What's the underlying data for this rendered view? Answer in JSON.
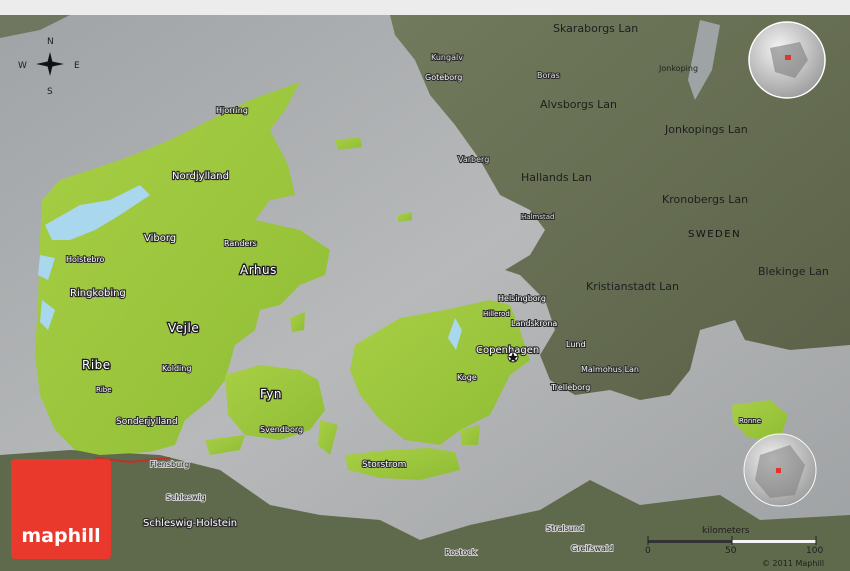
{
  "map": {
    "country": "Denmark",
    "style": "satellite, desaturated, with 3D relief",
    "colors": {
      "land_highlight": "#9dc93a",
      "water": "#a8acae",
      "neighbor_land": "#6a7257"
    }
  },
  "compass": {
    "north": "N",
    "south": "S",
    "east": "E",
    "west": "W"
  },
  "neighbor_country": "SWEDEN",
  "regions": {
    "nordjylland": "Nordjylland",
    "arhus": "Arhus",
    "ringkobing": "Ringkobing",
    "vejle": "Vejle",
    "ribe": "Ribe",
    "fyn": "Fyn",
    "sonderjylland": "Sonderjylland",
    "storstrom": "Storstrom",
    "schleswig_holstein": "Schleswig-Holstein",
    "skaraborgs": "Skaraborgs Lan",
    "alvsborgs": "Alvsborgs Lan",
    "jonkopings": "Jonkopings Lan",
    "hallands": "Hallands Lan",
    "kronobergs": "Kronobergs Lan",
    "kristianstadt": "Kristianstadt Lan",
    "blekinge": "Blekinge Lan",
    "malmohus": "Malmohus Lan"
  },
  "cities": {
    "hjorring": "Hjorring",
    "viborg": "Viborg",
    "randers": "Randers",
    "holstebro": "Holstebro",
    "kolding": "Kolding",
    "ribe": "Ribe",
    "svendborg": "Svendborg",
    "flensburg": "Flensburg",
    "schleswig": "Schleswig",
    "hillerod": "Hillerod",
    "koge": "Koge",
    "copenhagen": "Copenhagen",
    "helsingborg": "Helsingborg",
    "landskrona": "Landskrona",
    "lund": "Lund",
    "trelleborg": "Trelleborg",
    "ronne": "Ronne",
    "stralsund": "Stralsund",
    "greifswald": "Greifswald",
    "rostock": "Rostock",
    "kungalv": "Kungalv",
    "goteborg": "Goteborg",
    "boras": "Boras",
    "varberg": "Varberg",
    "halmstad": "Halmstad",
    "jonkoping": "Jonkoping"
  },
  "scale": {
    "title": "kilometers",
    "ticks": [
      "0",
      "50",
      "100"
    ]
  },
  "logo": "maphill",
  "copyright": "© 2011 Maphill"
}
